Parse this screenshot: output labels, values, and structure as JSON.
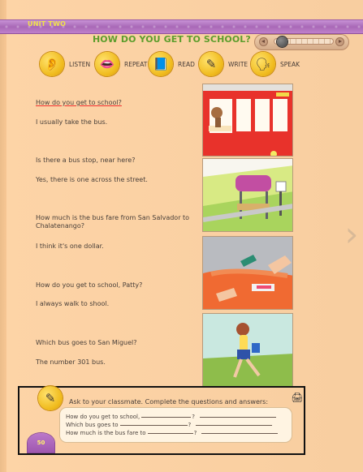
{
  "header": {
    "unit_label": "UNIT TWO",
    "title": "HOW DO YOU GET TO SCHOOL?"
  },
  "skills": [
    {
      "label": "LISTEN",
      "icon": "ear-icon"
    },
    {
      "label": "REPEAT",
      "icon": "mouth-icon"
    },
    {
      "label": "READ",
      "icon": "book-icon"
    },
    {
      "label": "WRITE",
      "icon": "pencil-icon"
    },
    {
      "label": "SPEAK",
      "icon": "speech-icon"
    }
  ],
  "dialogue": [
    {
      "question": "How do you get to school?",
      "answer": "I usually take the bus."
    },
    {
      "question": "Is there a bus stop, near here?",
      "answer": "Yes, there is one across the street."
    },
    {
      "question": "How much is the bus fare from San Salvador to Chalatenango?",
      "answer": "I think it's one dollar."
    },
    {
      "question": "How do you get to school, Patty?",
      "answer": "I always walk to shool."
    },
    {
      "question": "Which bus goes to San Miguel?",
      "answer": "The number 301 bus."
    }
  ],
  "activity": {
    "instruction": "Ask to your classmate. Complete the questions and answers:",
    "rows": [
      {
        "prompt": "How do you get to school,",
        "mark": "?"
      },
      {
        "prompt": "Which bus goes to",
        "mark": "?"
      },
      {
        "prompt": "How much is the bus fare to",
        "mark": "?"
      }
    ]
  },
  "page_number": "50",
  "colors": {
    "background": "#fdd2a3",
    "title_green": "#5c9d2c",
    "banner_purple": "#b173bf",
    "skill_yellow": "#f0bb1d"
  }
}
